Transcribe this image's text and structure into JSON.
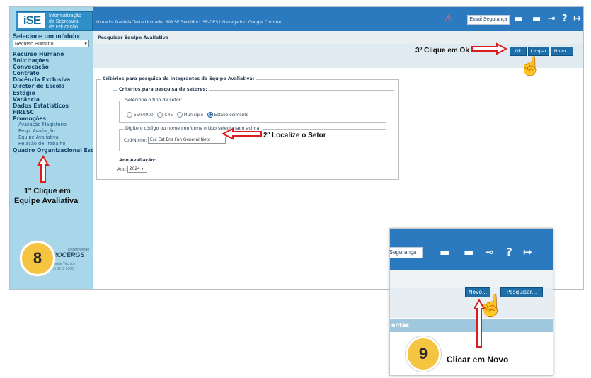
{
  "sidebar": {
    "logo_text": "iSE",
    "logo_lines": [
      "Informatização",
      "da Secretaria",
      "de Educação"
    ],
    "module_label": "Selecione um módulo:",
    "module_value": "Recurso Humano",
    "menu": [
      {
        "label": "Recurso Humano",
        "sub": false
      },
      {
        "label": "Solicitações",
        "sub": false
      },
      {
        "label": "Convocação",
        "sub": false
      },
      {
        "label": "Contrato",
        "sub": false
      },
      {
        "label": "Docência Exclusiva",
        "sub": false
      },
      {
        "label": "Diretor de Escola",
        "sub": false
      },
      {
        "label": "Estágio",
        "sub": false
      },
      {
        "label": "Vacância",
        "sub": false
      },
      {
        "label": "Dados Estatísticos",
        "sub": false
      },
      {
        "label": "FIRESC",
        "sub": false
      },
      {
        "label": "Promoções",
        "sub": false
      },
      {
        "label": "Avaliação Magistério",
        "sub": true
      },
      {
        "label": "Resp. Avaliação",
        "sub": true
      },
      {
        "label": "Equipe Avaliativa",
        "sub": true
      },
      {
        "label": "Relação de Trabalho",
        "sub": true
      },
      {
        "label": "Quadro Organizacional Escola",
        "sub": false
      }
    ],
    "footer_org": "PROCERGS",
    "footer_t1": "Desenvolvido Pela",
    "footer_t2": "Suporte Técnico",
    "footer_t3": "(51) 3210 3700"
  },
  "header": {
    "user_info": "Usuario: Daniela Teste Unidade: 30ª SE Servidor: ISE-DES1 Navegador: Google Chrome",
    "email_button": "Email Segurança"
  },
  "page": {
    "title": "Pesquisar Equipe Avaliativa",
    "buttons": {
      "ok": "Ok",
      "limpar": "Limpar",
      "novo": "Novo..."
    }
  },
  "form": {
    "main_legend": "Critérios para pesquisa de integrantes da Equipe Avaliativa:",
    "setor_legend": "Critérios para pesquisa de setores:",
    "tipo_legend": "Selecione o tipo de setor:",
    "radio_options": [
      "SE/50000",
      "CRE",
      "Municipio",
      "Estabelecimento"
    ],
    "selected_option": "Estabelecimento",
    "codigo_legend": "Digite o código ou nome conforme o tipo selecionado acima:",
    "codnome_label": "Cod/Nome:",
    "codnome_value": "Esc Est Ens Fun General Neto",
    "ano_legend": "Ano Avaliação:",
    "ano_label": "Ano:",
    "ano_value": "2024"
  },
  "annotations": {
    "step3": "3º Clique em Ok",
    "step2": "2º Localize o Setor",
    "step1_line1": "1º Clique em",
    "step1_line2": "Equipe Avaliativa",
    "badge8": "8",
    "badge9": "9",
    "step9_text": "Clicar em Novo"
  },
  "inset": {
    "email_button": "Segurança",
    "novo": "Novo...",
    "pesquisar": "Pesquisar...",
    "section_label": "entes"
  }
}
